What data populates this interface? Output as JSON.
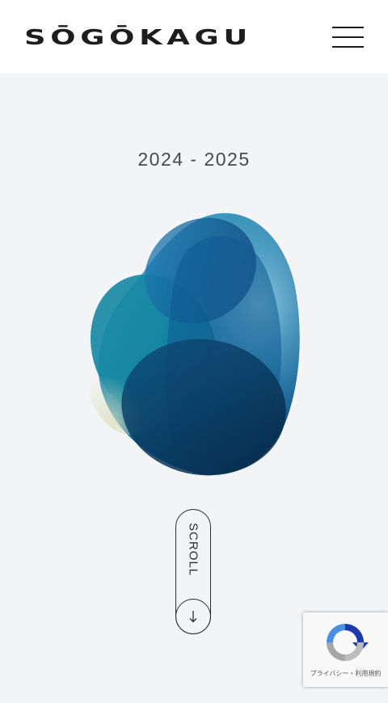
{
  "header": {
    "logo_text": "SŌGŌKAGU",
    "menu_icon": "hamburger-icon"
  },
  "hero": {
    "year_range": "2024 - 2025",
    "graphic": "abstract-blob-graphic"
  },
  "scroll_indicator": {
    "label": "SCROLL",
    "icon": "arrow-down-icon"
  },
  "recaptcha": {
    "icon": "recaptcha-icon",
    "privacy_label": "プライバシー",
    "separator": "・",
    "terms_label": "利用規約"
  },
  "colors": {
    "header_bg": "#ffffff",
    "page_bg": "#f3f4f6",
    "text_dark": "#1d1d1d",
    "accent_blue": "#0a5fa8",
    "accent_teal": "#14a0b5",
    "deep_navy": "#0a2f52"
  }
}
